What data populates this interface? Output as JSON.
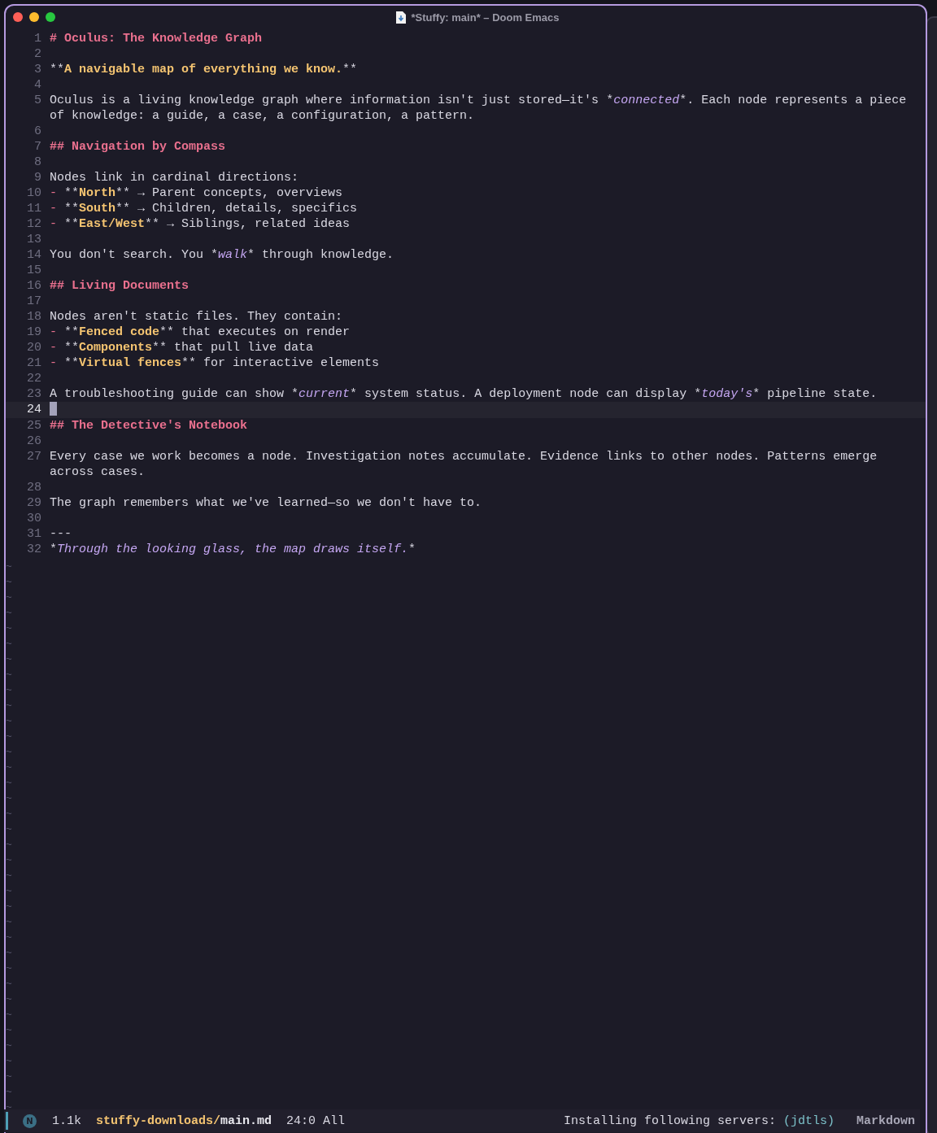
{
  "window": {
    "title": "*Stuffy: main* – Doom Emacs"
  },
  "lines": [
    {
      "number": "1",
      "current": false,
      "segments": [
        {
          "kind": "heading",
          "text": "# Oculus: The Knowledge Graph"
        }
      ]
    },
    {
      "number": "2",
      "current": false
    },
    {
      "number": "3",
      "current": false,
      "segments": [
        {
          "kind": "marker",
          "text": "**"
        },
        {
          "kind": "strong",
          "text": "A navigable map of everything we know."
        },
        {
          "kind": "marker",
          "text": "**"
        }
      ]
    },
    {
      "number": "4",
      "current": false
    },
    {
      "number": "5",
      "current": false,
      "segments": [
        {
          "kind": "plain",
          "text": "Oculus is a living knowledge graph where information isn't just stored—it's "
        },
        {
          "kind": "marker",
          "text": "*"
        },
        {
          "kind": "italic",
          "text": "connected"
        },
        {
          "kind": "marker",
          "text": "*"
        },
        {
          "kind": "plain",
          "text": ". Each node represents a piece of knowledge: a guide, a case, a configuration, a pattern."
        }
      ]
    },
    {
      "number": "6",
      "current": false
    },
    {
      "number": "7",
      "current": false,
      "segments": [
        {
          "kind": "heading",
          "text": "## Navigation by Compass"
        }
      ]
    },
    {
      "number": "8",
      "current": false
    },
    {
      "number": "9",
      "current": false,
      "segments": [
        {
          "kind": "plain",
          "text": "Nodes link in cardinal directions:"
        }
      ]
    },
    {
      "number": "10",
      "current": false,
      "segments": [
        {
          "kind": "bullet",
          "text": "- "
        },
        {
          "kind": "marker",
          "text": "**"
        },
        {
          "kind": "strong",
          "text": "North"
        },
        {
          "kind": "marker",
          "text": "**"
        },
        {
          "kind": "plain",
          "text": " → Parent concepts, overviews"
        }
      ]
    },
    {
      "number": "11",
      "current": false,
      "segments": [
        {
          "kind": "bullet",
          "text": "- "
        },
        {
          "kind": "marker",
          "text": "**"
        },
        {
          "kind": "strong",
          "text": "South"
        },
        {
          "kind": "marker",
          "text": "**"
        },
        {
          "kind": "plain",
          "text": " → Children, details, specifics"
        }
      ]
    },
    {
      "number": "12",
      "current": false,
      "segments": [
        {
          "kind": "bullet",
          "text": "- "
        },
        {
          "kind": "marker",
          "text": "**"
        },
        {
          "kind": "strong",
          "text": "East/West"
        },
        {
          "kind": "marker",
          "text": "**"
        },
        {
          "kind": "plain",
          "text": " → Siblings, related ideas"
        }
      ]
    },
    {
      "number": "13",
      "current": false
    },
    {
      "number": "14",
      "current": false,
      "segments": [
        {
          "kind": "plain",
          "text": "You don't search. You "
        },
        {
          "kind": "marker",
          "text": "*"
        },
        {
          "kind": "italic",
          "text": "walk"
        },
        {
          "kind": "marker",
          "text": "*"
        },
        {
          "kind": "plain",
          "text": " through knowledge."
        }
      ]
    },
    {
      "number": "15",
      "current": false
    },
    {
      "number": "16",
      "current": false,
      "segments": [
        {
          "kind": "heading",
          "text": "## Living Documents"
        }
      ]
    },
    {
      "number": "17",
      "current": false
    },
    {
      "number": "18",
      "current": false,
      "segments": [
        {
          "kind": "plain",
          "text": "Nodes aren't static files. They contain:"
        }
      ]
    },
    {
      "number": "19",
      "current": false,
      "segments": [
        {
          "kind": "bullet",
          "text": "- "
        },
        {
          "kind": "marker",
          "text": "**"
        },
        {
          "kind": "strong",
          "text": "Fenced code"
        },
        {
          "kind": "marker",
          "text": "**"
        },
        {
          "kind": "plain",
          "text": " that executes on render"
        }
      ]
    },
    {
      "number": "20",
      "current": false,
      "segments": [
        {
          "kind": "bullet",
          "text": "- "
        },
        {
          "kind": "marker",
          "text": "**"
        },
        {
          "kind": "strong",
          "text": "Components"
        },
        {
          "kind": "marker",
          "text": "**"
        },
        {
          "kind": "plain",
          "text": " that pull live data"
        }
      ]
    },
    {
      "number": "21",
      "current": false,
      "segments": [
        {
          "kind": "bullet",
          "text": "- "
        },
        {
          "kind": "marker",
          "text": "**"
        },
        {
          "kind": "strong",
          "text": "Virtual fences"
        },
        {
          "kind": "marker",
          "text": "**"
        },
        {
          "kind": "plain",
          "text": " for interactive elements"
        }
      ]
    },
    {
      "number": "22",
      "current": false
    },
    {
      "number": "23",
      "current": false,
      "segments": [
        {
          "kind": "plain",
          "text": "A troubleshooting guide can show "
        },
        {
          "kind": "marker",
          "text": "*"
        },
        {
          "kind": "italic",
          "text": "current"
        },
        {
          "kind": "marker",
          "text": "*"
        },
        {
          "kind": "plain",
          "text": " system status. A deployment node can display "
        },
        {
          "kind": "marker",
          "text": "*"
        },
        {
          "kind": "italic",
          "text": "today's"
        },
        {
          "kind": "marker",
          "text": "*"
        },
        {
          "kind": "plain",
          "text": " pipeline state."
        }
      ]
    },
    {
      "number": "24",
      "current": true
    },
    {
      "number": "25",
      "current": false,
      "segments": [
        {
          "kind": "heading",
          "text": "## The Detective's Notebook"
        }
      ]
    },
    {
      "number": "26",
      "current": false
    },
    {
      "number": "27",
      "current": false,
      "segments": [
        {
          "kind": "plain",
          "text": "Every case we work becomes a node. Investigation notes accumulate. Evidence links to other nodes. Patterns emerge across cases."
        }
      ]
    },
    {
      "number": "28",
      "current": false
    },
    {
      "number": "29",
      "current": false,
      "segments": [
        {
          "kind": "plain",
          "text": "The graph remembers what we've learned—so we don't have to."
        }
      ]
    },
    {
      "number": "30",
      "current": false
    },
    {
      "number": "31",
      "current": false,
      "segments": [
        {
          "kind": "plain",
          "text": "---"
        }
      ]
    },
    {
      "number": "32",
      "current": false,
      "segments": [
        {
          "kind": "marker",
          "text": "*"
        },
        {
          "kind": "italic",
          "text": "Through the looking glass, the map draws itself."
        },
        {
          "kind": "marker",
          "text": "*"
        }
      ]
    }
  ],
  "fringe_marks": [
    "~",
    "~",
    "~",
    "~",
    "~",
    "~",
    "~",
    "~",
    "~",
    "~",
    "~",
    "~",
    "~",
    "~",
    "~",
    "~",
    "~",
    "~",
    "~",
    "~",
    "~",
    "~",
    "~",
    "~",
    "~",
    "~",
    "~",
    "~",
    "~",
    "~",
    "~",
    "~",
    "~",
    "~",
    "~",
    "~"
  ],
  "status_bar": {
    "mode": "N",
    "size": "1.1k",
    "directory": "stuffy-downloads/",
    "file": "main.md",
    "position": "24:0",
    "scroll": "All",
    "message": "Installing following servers:",
    "servers": "(jdtls)",
    "major_mode": "Markdown"
  }
}
